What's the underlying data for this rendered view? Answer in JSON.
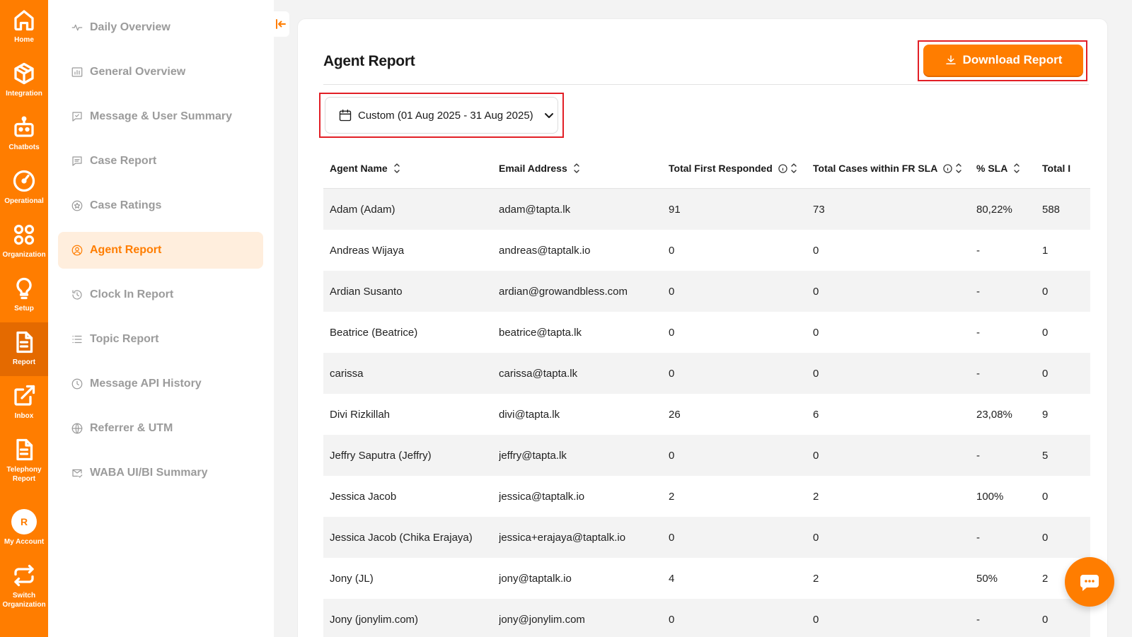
{
  "rail": {
    "items": [
      {
        "label": "Home",
        "icon": "home-icon"
      },
      {
        "label": "Integration",
        "icon": "cube-icon"
      },
      {
        "label": "Chatbots",
        "icon": "robot-icon"
      },
      {
        "label": "Operational",
        "icon": "gauge-icon"
      },
      {
        "label": "Organization",
        "icon": "grid-circles-icon"
      },
      {
        "label": "Setup",
        "icon": "lightbulb-icon"
      },
      {
        "label": "Report",
        "icon": "document-icon",
        "active": true
      },
      {
        "label": "Inbox",
        "icon": "external-link-icon"
      },
      {
        "label": "Telephony Report",
        "icon": "document-icon"
      },
      {
        "label": "My Account",
        "icon": "avatar",
        "avatar_letter": "R"
      },
      {
        "label": "Switch Organization",
        "icon": "swap-icon"
      }
    ]
  },
  "submenu": {
    "items": [
      {
        "label": "Daily Overview",
        "icon": "pulse-icon"
      },
      {
        "label": "General Overview",
        "icon": "bar-chart-icon"
      },
      {
        "label": "Message & User Summary",
        "icon": "message-check-icon"
      },
      {
        "label": "Case Report",
        "icon": "message-lines-icon"
      },
      {
        "label": "Case Ratings",
        "icon": "star-circle-icon"
      },
      {
        "label": "Agent Report",
        "icon": "user-circle-icon",
        "active": true
      },
      {
        "label": "Clock In Report",
        "icon": "clock-arrow-icon"
      },
      {
        "label": "Topic Report",
        "icon": "list-icon"
      },
      {
        "label": "Message API History",
        "icon": "history-icon"
      },
      {
        "label": "Referrer & UTM",
        "icon": "globe-icon"
      },
      {
        "label": "WABA UI/BI Summary",
        "icon": "mail-check-icon"
      }
    ]
  },
  "page": {
    "title": "Agent Report",
    "download_label": "Download Report",
    "date_range": "Custom (01 Aug 2025 - 31 Aug 2025)"
  },
  "table": {
    "columns": [
      "Agent Name",
      "Email Address",
      "Total First Responded",
      "Total Cases within FR SLA",
      "% SLA",
      "Total I"
    ],
    "rows": [
      [
        "Adam (Adam)",
        "adam@tapta.lk",
        "91",
        "73",
        "80,22%",
        "588"
      ],
      [
        "Andreas Wijaya",
        "andreas@taptalk.io",
        "0",
        "0",
        "-",
        "1"
      ],
      [
        "Ardian Susanto",
        "ardian@growandbless.com",
        "0",
        "0",
        "-",
        "0"
      ],
      [
        "Beatrice (Beatrice)",
        "beatrice@tapta.lk",
        "0",
        "0",
        "-",
        "0"
      ],
      [
        "carissa",
        "carissa@tapta.lk",
        "0",
        "0",
        "-",
        "0"
      ],
      [
        "Divi Rizkillah",
        "divi@tapta.lk",
        "26",
        "6",
        "23,08%",
        "9"
      ],
      [
        "Jeffry Saputra (Jeffry)",
        "jeffry@tapta.lk",
        "0",
        "0",
        "-",
        "5"
      ],
      [
        "Jessica Jacob",
        "jessica@taptalk.io",
        "2",
        "2",
        "100%",
        "0"
      ],
      [
        "Jessica Jacob (Chika Erajaya)",
        "jessica+erajaya@taptalk.io",
        "0",
        "0",
        "-",
        "0"
      ],
      [
        "Jony (JL)",
        "jony@taptalk.io",
        "4",
        "2",
        "50%",
        "2"
      ],
      [
        "Jony (jonylim.com)",
        "jony@jonylim.com",
        "0",
        "0",
        "-",
        "0"
      ]
    ]
  },
  "colors": {
    "accent": "#ff7d00",
    "accent_dark": "#e46a00",
    "highlight_border": "#e21f26",
    "active_bg": "#ffeedd"
  }
}
